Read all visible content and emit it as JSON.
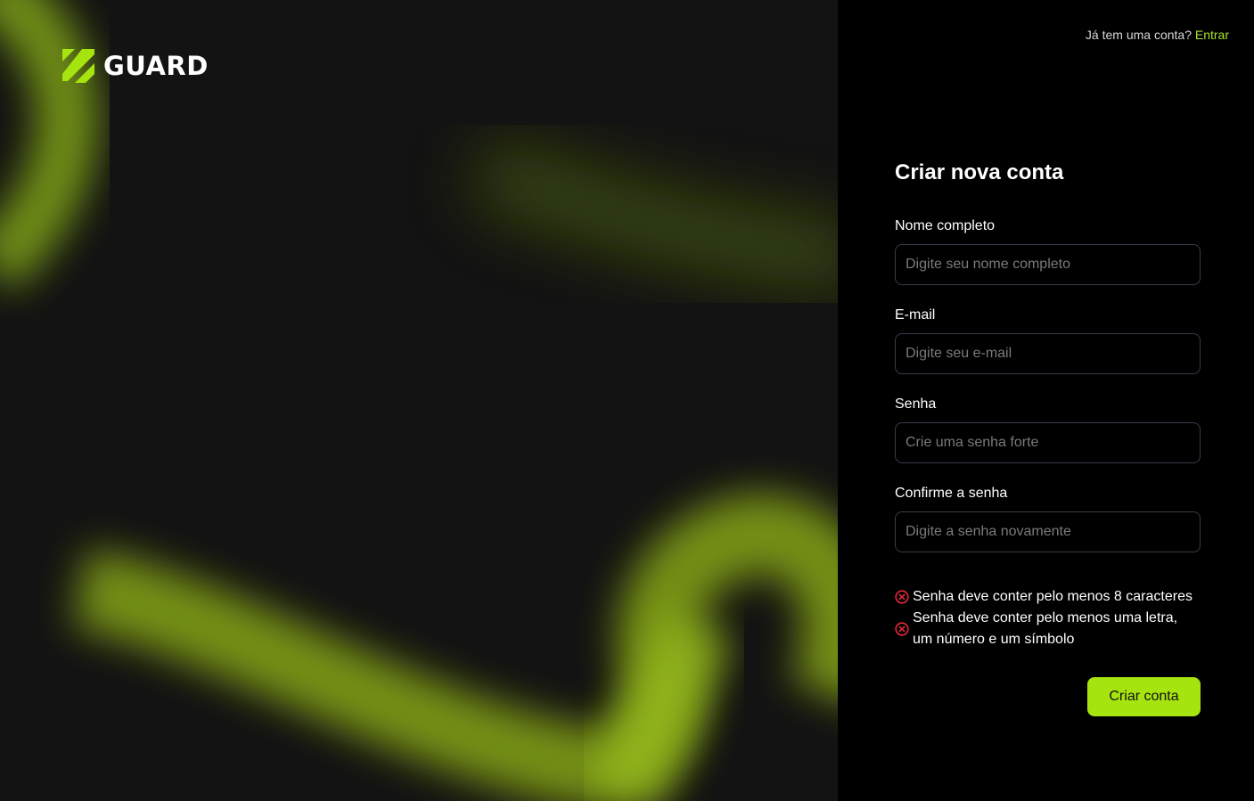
{
  "brand": {
    "name": "GUARD",
    "accent": "#a6e40f"
  },
  "header": {
    "prompt": "Já tem uma conta?",
    "login_link": "Entrar"
  },
  "form": {
    "title": "Criar nova conta",
    "fields": [
      {
        "label": "Nome completo",
        "placeholder": "Digite seu nome completo"
      },
      {
        "label": "E-mail",
        "placeholder": "Digite seu e-mail"
      },
      {
        "label": "Senha",
        "placeholder": "Crie uma senha forte"
      },
      {
        "label": "Confirme a senha",
        "placeholder": "Digite a senha novamente"
      }
    ],
    "rules": [
      {
        "icon": "error-circle-icon",
        "text": "Senha deve conter pelo menos 8 caracteres"
      },
      {
        "icon": "error-circle-icon",
        "text": "Senha deve conter pelo menos uma letra, um número e um símbolo"
      }
    ],
    "submit_label": "Criar conta"
  },
  "colors": {
    "error": "#e5293a",
    "input_border": "#3b3b4a",
    "hero_bg": "#131313"
  }
}
